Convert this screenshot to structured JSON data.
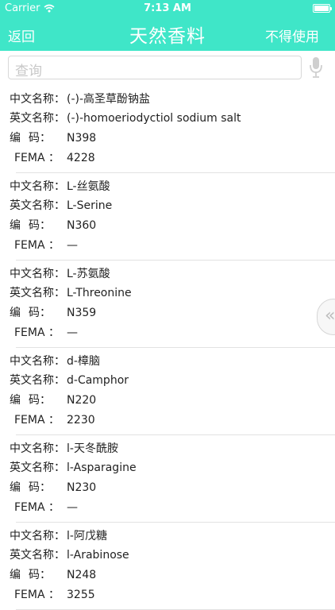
{
  "status_bar": {
    "carrier": "Carrier",
    "time": "7:13 AM",
    "battery_level": 1.0
  },
  "nav": {
    "back_label": "返回",
    "title": "天然香料",
    "right_label": "不得使用"
  },
  "search": {
    "placeholder": "查询"
  },
  "labels": {
    "cn": "中文名称：",
    "en": "英文名称：",
    "code_a": "编",
    "code_b": "码：",
    "fema": "FEMA  ："
  },
  "items": [
    {
      "cn": "(-)-高圣草酚钠盐",
      "en": "(-)-homoeriodyctiol sodium salt",
      "code": "N398",
      "fema": "4228"
    },
    {
      "cn": "L-丝氨酸",
      "en": "L-Serine",
      "code": "N360",
      "fema": "—"
    },
    {
      "cn": "L-苏氨酸",
      "en": "L-Threonine",
      "code": "N359",
      "fema": "—"
    },
    {
      "cn": "d-樟脑",
      "en": "d-Camphor",
      "code": "N220",
      "fema": "2230"
    },
    {
      "cn": "l-天冬酰胺",
      "en": "l-Asparagine",
      "code": "N230",
      "fema": "—"
    },
    {
      "cn": "l-阿戊糖",
      "en": "l-Arabinose",
      "code": "N248",
      "fema": "3255"
    }
  ],
  "side_handle": {
    "glyph": "«"
  },
  "colors": {
    "accent": "#3fe6c8"
  }
}
